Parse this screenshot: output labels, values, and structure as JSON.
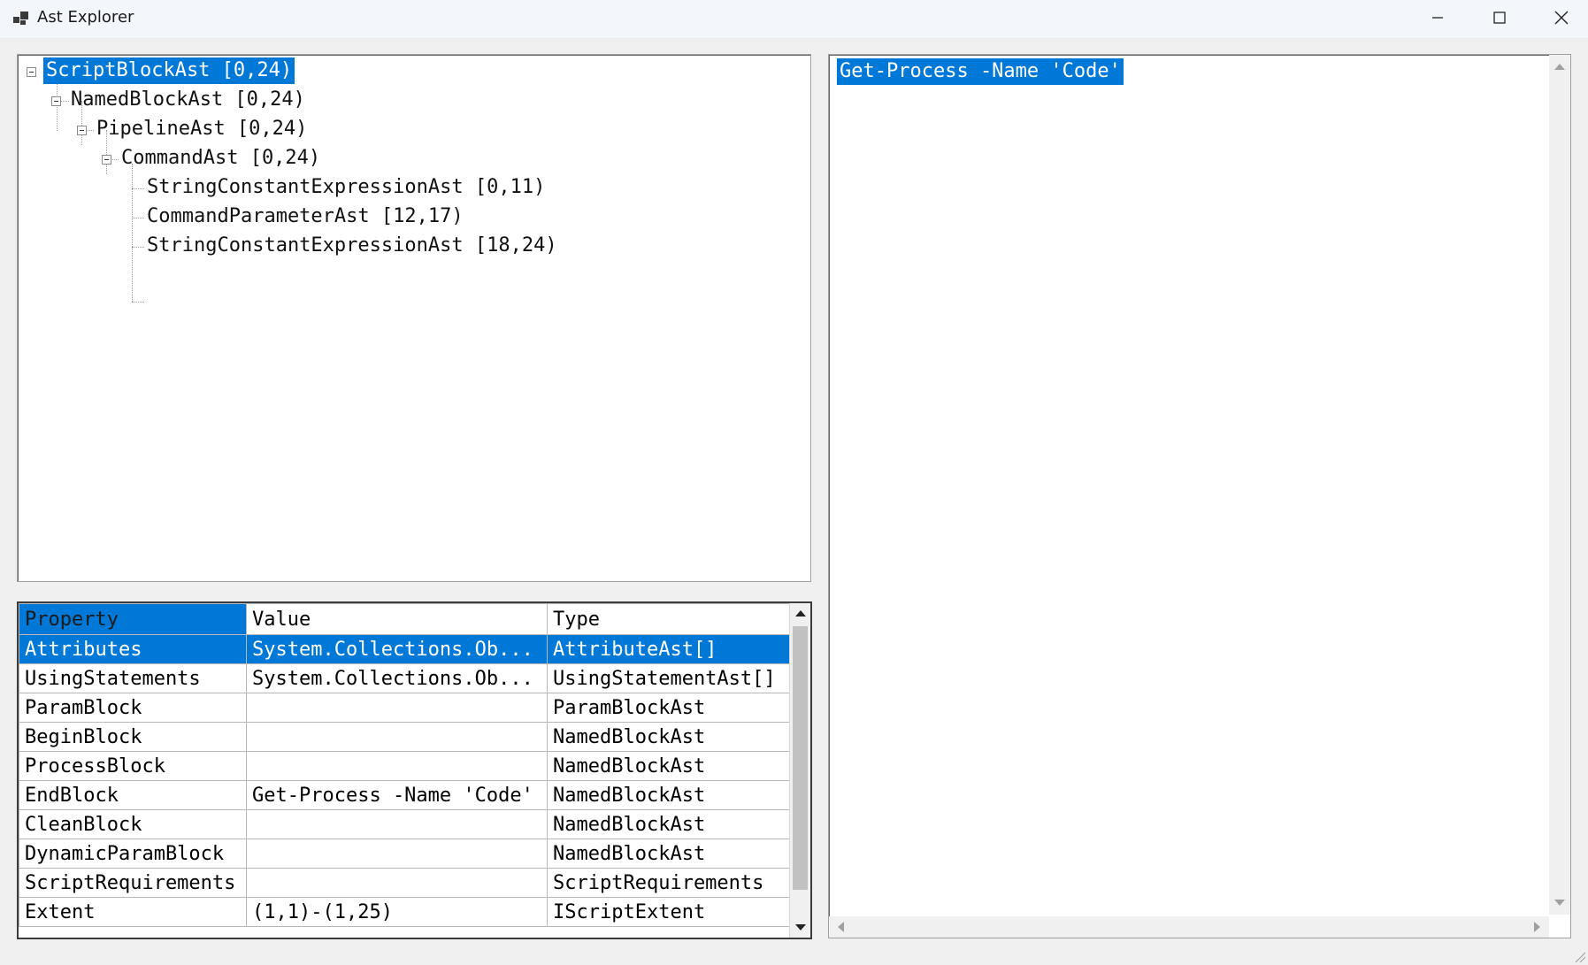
{
  "window": {
    "title": "Ast Explorer",
    "icons": {
      "app": "app-icon",
      "minimize": "minimize-icon",
      "maximize": "maximize-icon",
      "close": "close-icon"
    }
  },
  "tree": {
    "nodes": [
      {
        "label": "ScriptBlockAst [0,24)",
        "selected": true,
        "expanded": true
      },
      {
        "label": "NamedBlockAst [0,24)",
        "expanded": true
      },
      {
        "label": "PipelineAst [0,24)",
        "expanded": true
      },
      {
        "label": "CommandAst [0,24)",
        "expanded": true
      },
      {
        "label": "StringConstantExpressionAst [0,11)"
      },
      {
        "label": "CommandParameterAst [12,17)"
      },
      {
        "label": "StringConstantExpressionAst [18,24)"
      }
    ]
  },
  "grid": {
    "columns": [
      "Property",
      "Value",
      "Type"
    ],
    "rows": [
      {
        "property": "Attributes",
        "value": "System.Collections.Ob...",
        "type": "AttributeAst[]",
        "selected": true
      },
      {
        "property": "UsingStatements",
        "value": "System.Collections.Ob...",
        "type": "UsingStatementAst[]"
      },
      {
        "property": "ParamBlock",
        "value": "",
        "type": "ParamBlockAst"
      },
      {
        "property": "BeginBlock",
        "value": "",
        "type": "NamedBlockAst"
      },
      {
        "property": "ProcessBlock",
        "value": "",
        "type": "NamedBlockAst"
      },
      {
        "property": "EndBlock",
        "value": "Get-Process -Name 'Code'",
        "type": "NamedBlockAst"
      },
      {
        "property": "CleanBlock",
        "value": "",
        "type": "NamedBlockAst"
      },
      {
        "property": "DynamicParamBlock",
        "value": "",
        "type": "NamedBlockAst"
      },
      {
        "property": "ScriptRequirements",
        "value": "",
        "type": "ScriptRequirements"
      },
      {
        "property": "Extent",
        "value": " (1,1)-(1,25)",
        "type": "IScriptExtent"
      }
    ]
  },
  "editor": {
    "text": "Get-Process -Name 'Code'"
  },
  "colors": {
    "selection": "#0078d7",
    "background": "#f0f0f0"
  }
}
